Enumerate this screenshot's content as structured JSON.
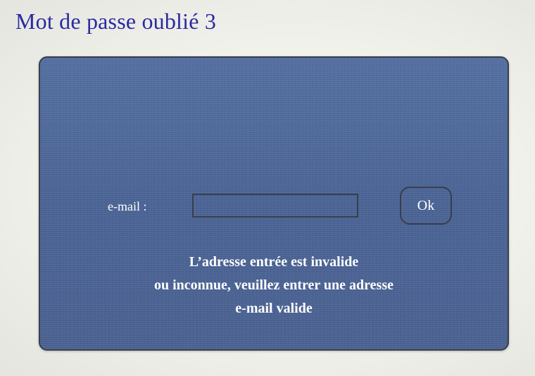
{
  "page": {
    "title": "Mot de passe oublié 3"
  },
  "form": {
    "email_label": "e-mail :",
    "email_value": "",
    "ok_label": "Ok"
  },
  "error": {
    "lines": [
      "L’adresse entrée est invalide",
      "ou inconnue, veuillez entrer une adresse",
      "e-mail valide"
    ]
  },
  "colors": {
    "title": "#2a2aa0",
    "panel": "#4c679b",
    "panel_border": "#3b3f4d",
    "text_on_panel": "#ffffff"
  }
}
